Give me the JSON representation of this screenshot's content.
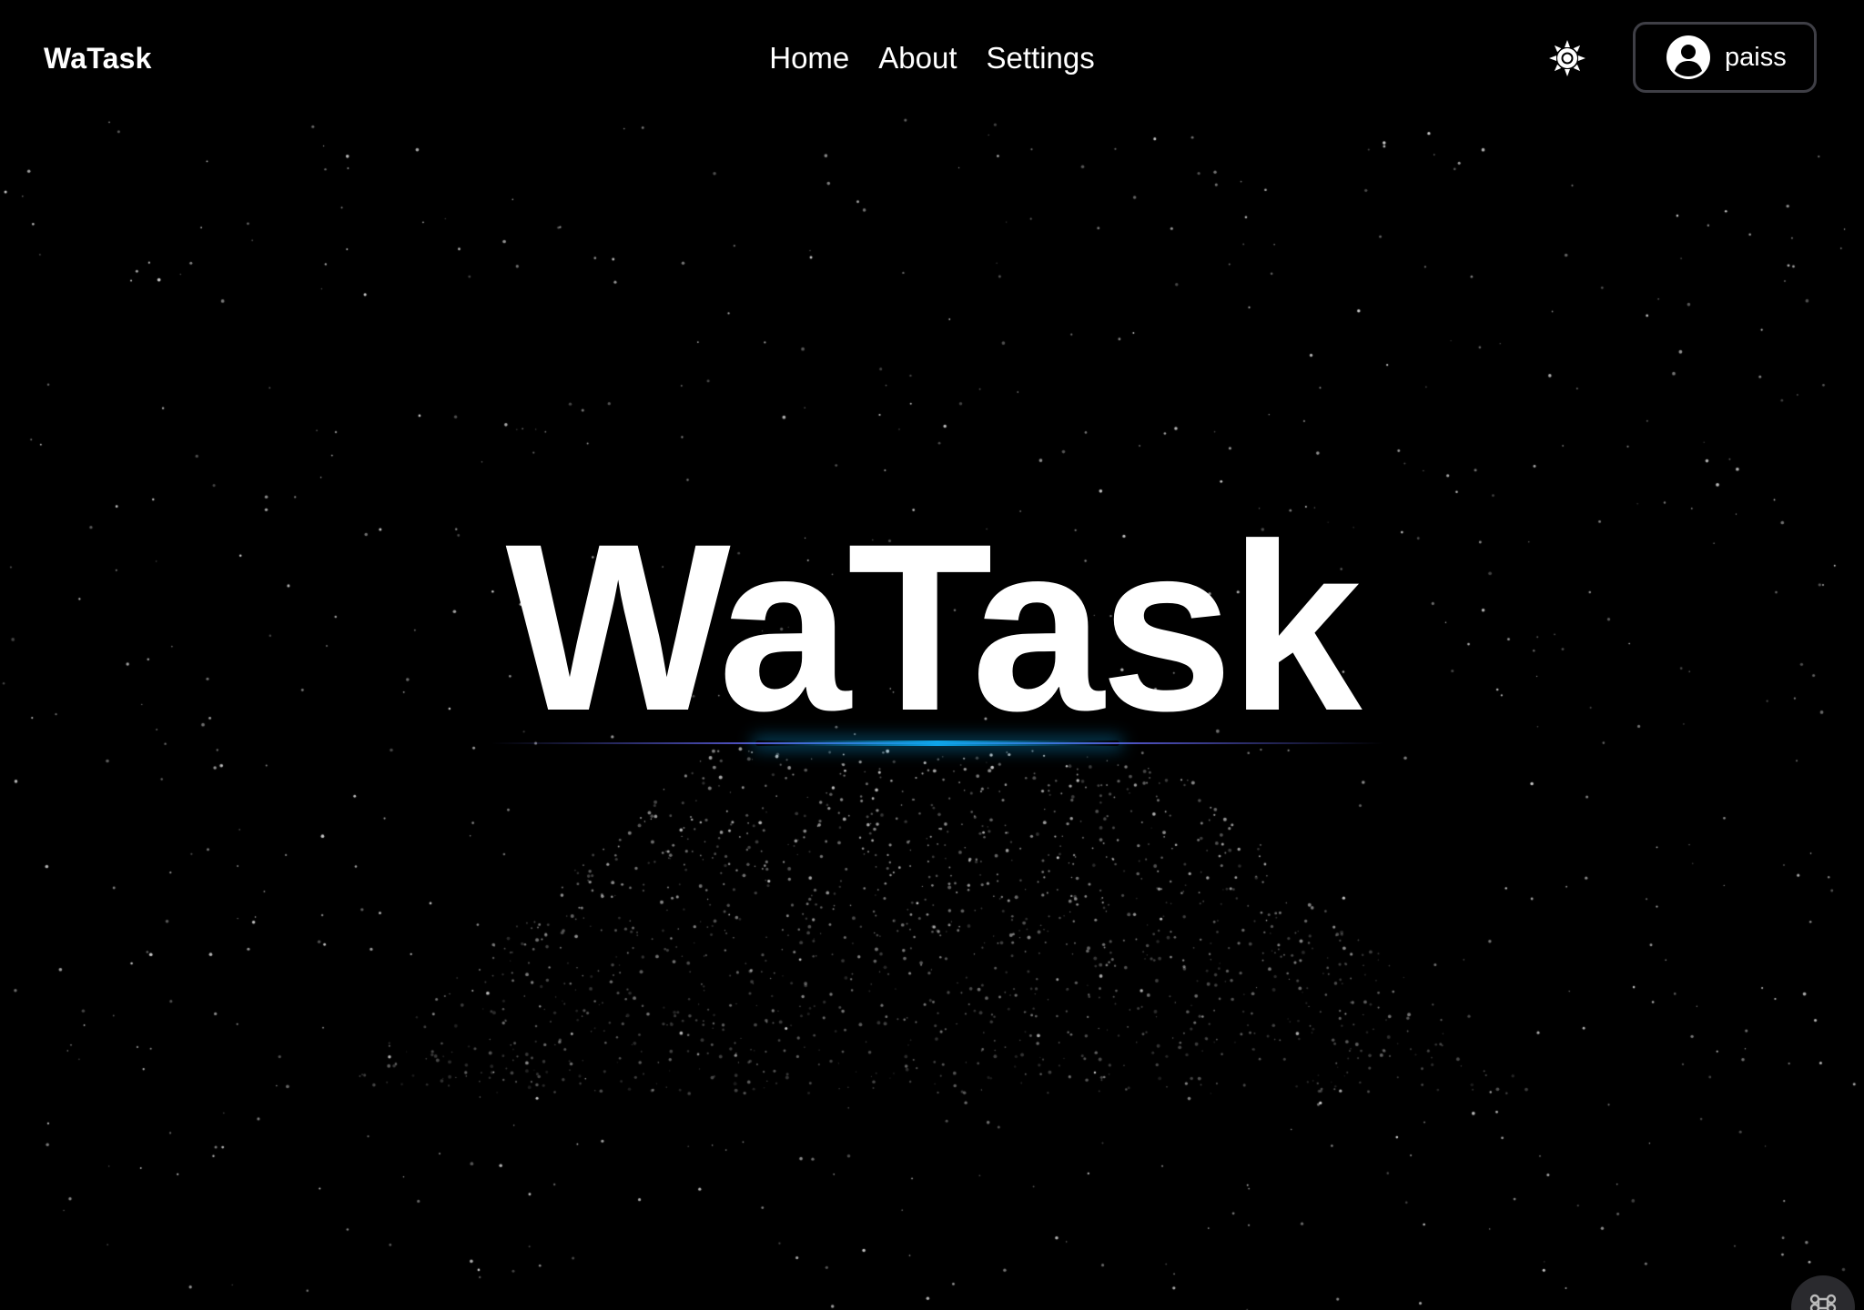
{
  "navbar": {
    "brand": "WaTask",
    "links": [
      {
        "label": "Home"
      },
      {
        "label": "About"
      },
      {
        "label": "Settings"
      }
    ],
    "theme_toggle_icon": "sun-icon",
    "user": {
      "icon": "user-circle-icon",
      "name": "paiss"
    }
  },
  "hero": {
    "title": "WaTask"
  },
  "corner_widget": {
    "icon": "command-icon"
  },
  "colors": {
    "background": "#000000",
    "text": "#ffffff",
    "accent_glow": "#0ea5e9",
    "accent_line": "#6366f1",
    "button_border": "#3f3f46"
  }
}
